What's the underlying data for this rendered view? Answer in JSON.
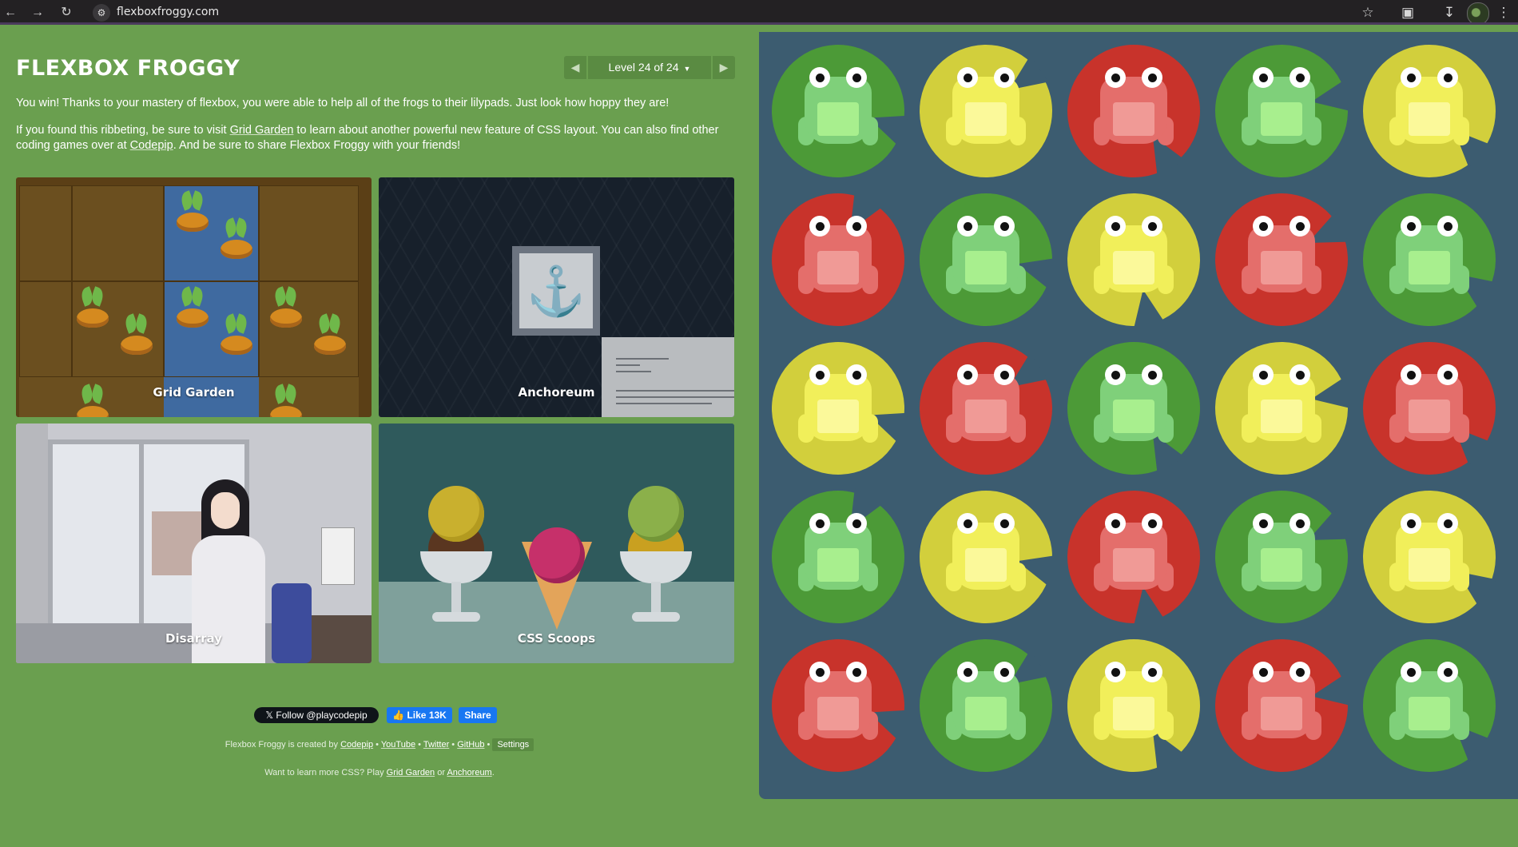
{
  "browser": {
    "url": "flexboxfroggy.com",
    "icons": [
      "back-arrow-icon",
      "forward-arrow-icon",
      "reload-icon",
      "site-info-icon",
      "bookmark-star-icon",
      "extensions-icon",
      "download-icon",
      "profile-avatar",
      "more-menu-icon"
    ]
  },
  "header": {
    "logo": "FLEXBOX FROGGY",
    "level_label": "Level 24 of 24"
  },
  "intro": {
    "win_text": "You win! Thanks to your mastery of flexbox, you were able to help all of the frogs to their lilypads. Just look how hoppy they are!",
    "p2_a": "If you found this ribbeting, be sure to visit ",
    "grid_garden_link": "Grid Garden",
    "p2_b": " to learn about another powerful new feature of CSS layout. You can also find other coding games over at ",
    "codepip_link": "Codepip",
    "p2_c": ". And be sure to share Flexbox Froggy with your friends!"
  },
  "games": [
    {
      "label": "Grid Garden"
    },
    {
      "label": "Anchoreum"
    },
    {
      "label": "Disarray"
    },
    {
      "label": "CSS Scoops"
    }
  ],
  "social": {
    "follow": "Follow @playcodepip",
    "like": "Like 13K",
    "share": "Share"
  },
  "footer": {
    "created_by": "Flexbox Froggy is created by ",
    "codepip": "Codepip",
    "youtube": "YouTube",
    "twitter": "Twitter",
    "github": "GitHub",
    "sep": " • ",
    "settings": "Settings",
    "learn_more": "Want to learn more CSS? Play ",
    "grid_garden": "Grid Garden",
    "or": " or ",
    "anchoreum": "Anchoreum",
    "end": "."
  },
  "pond": {
    "rows": [
      [
        "green",
        "yellow",
        "red",
        "green",
        "yellow"
      ],
      [
        "red",
        "green",
        "yellow",
        "red",
        "green"
      ],
      [
        "yellow",
        "red",
        "green",
        "yellow",
        "red"
      ],
      [
        "green",
        "yellow",
        "red",
        "green",
        "yellow"
      ],
      [
        "red",
        "green",
        "yellow",
        "red",
        "green"
      ]
    ],
    "colors": {
      "green": {
        "pad": "#4c9a37",
        "frog": "#7fd07a",
        "belly": "#a8ef8e"
      },
      "yellow": {
        "pad": "#d2cf3c",
        "frog": "#f1ef5a",
        "belly": "#fbf99a"
      },
      "red": {
        "pad": "#c8332b",
        "frog": "#e46e6b",
        "belly": "#f09a96"
      }
    }
  }
}
